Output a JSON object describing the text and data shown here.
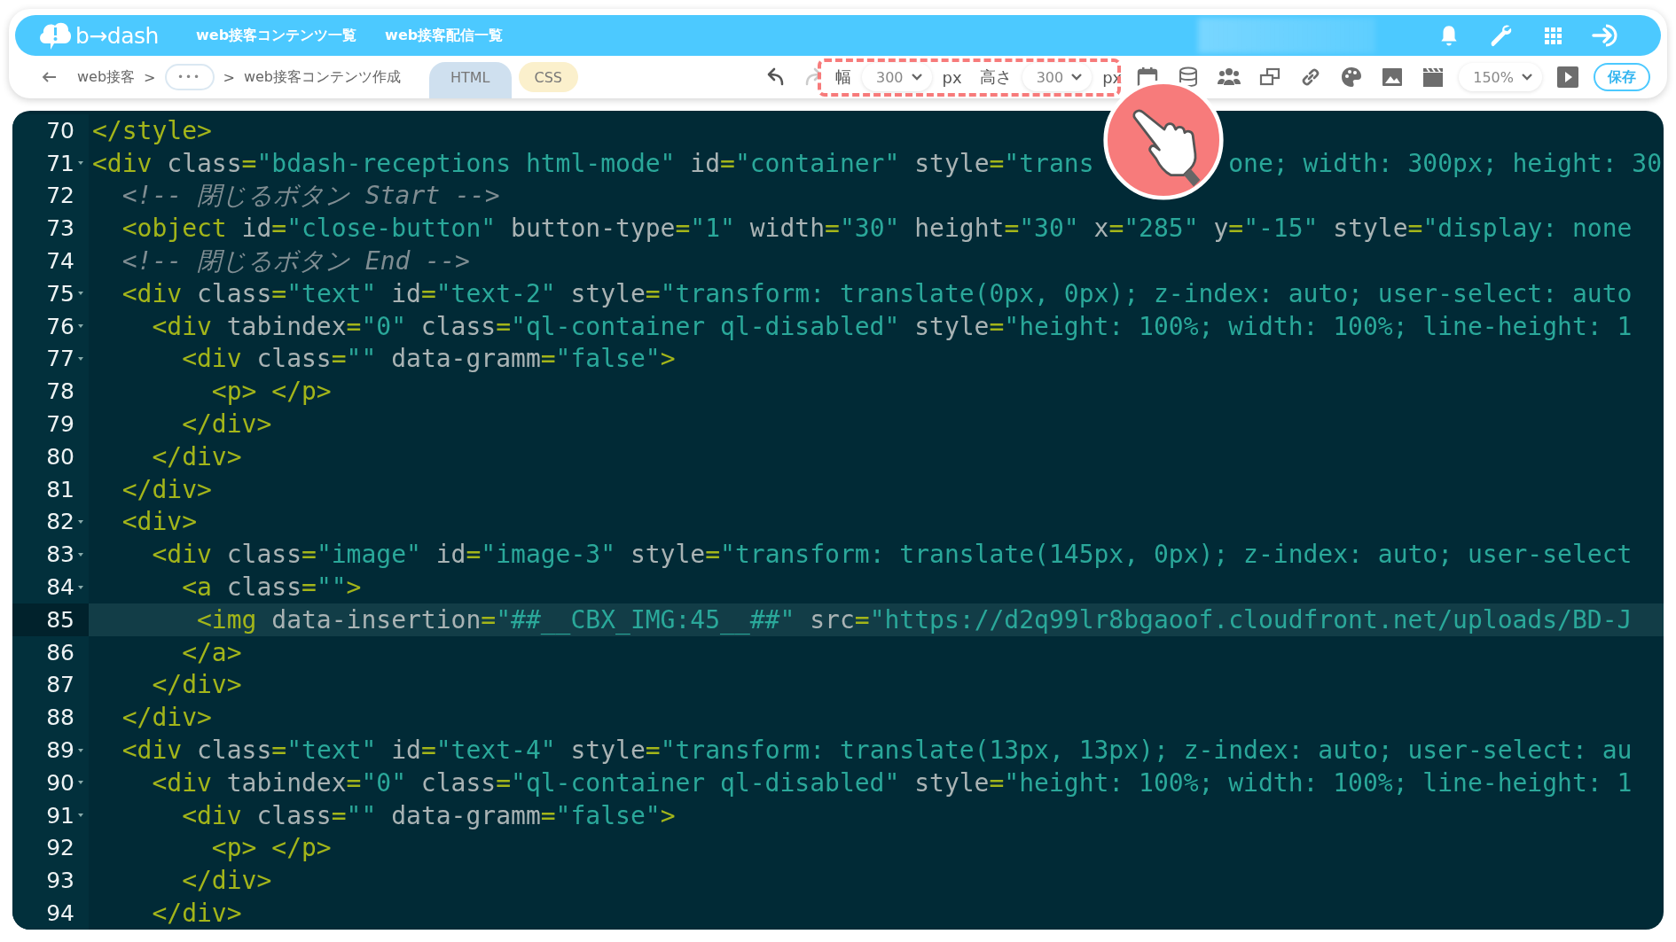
{
  "header": {
    "logo": "b→dash",
    "nav": [
      {
        "label": "web接客コンテンツ一覧"
      },
      {
        "label": "web接客配信一覧"
      }
    ]
  },
  "toolbar": {
    "breadcrumb": [
      {
        "kind": "link",
        "text": "web接客"
      },
      {
        "kind": "sep",
        "text": ">"
      },
      {
        "kind": "more",
        "text": "•••"
      },
      {
        "kind": "sep",
        "text": ">"
      },
      {
        "kind": "current",
        "text": "web接客コンテンツ作成"
      }
    ],
    "tabs": [
      {
        "label": "HTML",
        "selected": true,
        "color": "#cfe0ef"
      },
      {
        "label": "CSS",
        "selected": false,
        "color": "#fbf0cc"
      }
    ],
    "undo": {
      "disabled": false
    },
    "redo": {
      "disabled": true
    },
    "size": {
      "width_label": "幅",
      "width_value": "300",
      "width_unit": "px",
      "height_label": "高さ",
      "height_value": "300",
      "height_unit": "px"
    },
    "zoom": "150%",
    "save": "保存"
  },
  "editor": {
    "lines": [
      {
        "number": "70",
        "foldable": false,
        "active": false,
        "tokens": [
          {
            "kind": "tag",
            "text": "</style>"
          }
        ]
      },
      {
        "number": "71",
        "foldable": true,
        "active": false,
        "tokens": [
          {
            "kind": "tag",
            "text": "<div"
          },
          {
            "kind": "attr",
            "text": " class"
          },
          {
            "kind": "eq",
            "text": "="
          },
          {
            "kind": "str",
            "text": "\"bdash-receptions html-mode\""
          },
          {
            "kind": "attr",
            "text": " id"
          },
          {
            "kind": "eq",
            "text": "="
          },
          {
            "kind": "str",
            "text": "\"container\""
          },
          {
            "kind": "attr",
            "text": " style"
          },
          {
            "kind": "eq",
            "text": "="
          },
          {
            "kind": "str",
            "text": "\"trans"
          },
          {
            "kind": "str_after_overlay",
            "text": "one; width: 300px; height: 30"
          }
        ]
      },
      {
        "number": "72",
        "foldable": false,
        "active": false,
        "tokens": [
          {
            "kind": "comment",
            "text": "  <!-- 閉じるボタン Start -->"
          }
        ]
      },
      {
        "number": "73",
        "foldable": false,
        "active": false,
        "tokens": [
          {
            "kind": "tag",
            "text": "  <object"
          },
          {
            "kind": "attr",
            "text": " id"
          },
          {
            "kind": "eq",
            "text": "="
          },
          {
            "kind": "str",
            "text": "\"close-button\""
          },
          {
            "kind": "attr",
            "text": " button-type"
          },
          {
            "kind": "eq",
            "text": "="
          },
          {
            "kind": "str",
            "text": "\"1\""
          },
          {
            "kind": "attr",
            "text": " width"
          },
          {
            "kind": "eq",
            "text": "="
          },
          {
            "kind": "str",
            "text": "\"30\""
          },
          {
            "kind": "attr",
            "text": " height"
          },
          {
            "kind": "eq",
            "text": "="
          },
          {
            "kind": "str",
            "text": "\"30\""
          },
          {
            "kind": "attr",
            "text": " x"
          },
          {
            "kind": "eq",
            "text": "="
          },
          {
            "kind": "str",
            "text": "\"285\""
          },
          {
            "kind": "attr",
            "text": " y"
          },
          {
            "kind": "eq",
            "text": "="
          },
          {
            "kind": "str",
            "text": "\"-15\""
          },
          {
            "kind": "attr",
            "text": " style"
          },
          {
            "kind": "eq",
            "text": "="
          },
          {
            "kind": "str",
            "text": "\"display: none"
          }
        ]
      },
      {
        "number": "74",
        "foldable": false,
        "active": false,
        "tokens": [
          {
            "kind": "comment",
            "text": "  <!-- 閉じるボタン End -->"
          }
        ]
      },
      {
        "number": "75",
        "foldable": true,
        "active": false,
        "tokens": [
          {
            "kind": "tag",
            "text": "  <div"
          },
          {
            "kind": "attr",
            "text": " class"
          },
          {
            "kind": "eq",
            "text": "="
          },
          {
            "kind": "str",
            "text": "\"text\""
          },
          {
            "kind": "attr",
            "text": " id"
          },
          {
            "kind": "eq",
            "text": "="
          },
          {
            "kind": "str",
            "text": "\"text-2\""
          },
          {
            "kind": "attr",
            "text": " style"
          },
          {
            "kind": "eq",
            "text": "="
          },
          {
            "kind": "str",
            "text": "\"transform: translate(0px, 0px); z-index: auto; user-select: auto"
          }
        ]
      },
      {
        "number": "76",
        "foldable": true,
        "active": false,
        "tokens": [
          {
            "kind": "tag",
            "text": "    <div"
          },
          {
            "kind": "attr",
            "text": " tabindex"
          },
          {
            "kind": "eq",
            "text": "="
          },
          {
            "kind": "str",
            "text": "\"0\""
          },
          {
            "kind": "attr",
            "text": " class"
          },
          {
            "kind": "eq",
            "text": "="
          },
          {
            "kind": "str",
            "text": "\"ql-container ql-disabled\""
          },
          {
            "kind": "attr",
            "text": " style"
          },
          {
            "kind": "eq",
            "text": "="
          },
          {
            "kind": "str",
            "text": "\"height: 100%; width: 100%; line-height: 1"
          }
        ]
      },
      {
        "number": "77",
        "foldable": true,
        "active": false,
        "tokens": [
          {
            "kind": "tag",
            "text": "      <div"
          },
          {
            "kind": "attr",
            "text": " class"
          },
          {
            "kind": "eq",
            "text": "="
          },
          {
            "kind": "str",
            "text": "\"\""
          },
          {
            "kind": "attr",
            "text": " data-gramm"
          },
          {
            "kind": "eq",
            "text": "="
          },
          {
            "kind": "str",
            "text": "\"false\""
          },
          {
            "kind": "tag",
            "text": ">"
          }
        ]
      },
      {
        "number": "78",
        "foldable": false,
        "active": false,
        "tokens": [
          {
            "kind": "tag",
            "text": "        <p> </p>"
          }
        ]
      },
      {
        "number": "79",
        "foldable": false,
        "active": false,
        "tokens": [
          {
            "kind": "tag",
            "text": "      </div>"
          }
        ]
      },
      {
        "number": "80",
        "foldable": false,
        "active": false,
        "tokens": [
          {
            "kind": "tag",
            "text": "    </div>"
          }
        ]
      },
      {
        "number": "81",
        "foldable": false,
        "active": false,
        "tokens": [
          {
            "kind": "tag",
            "text": "  </div>"
          }
        ]
      },
      {
        "number": "82",
        "foldable": true,
        "active": false,
        "tokens": [
          {
            "kind": "tag",
            "text": "  <div>"
          }
        ]
      },
      {
        "number": "83",
        "foldable": true,
        "active": false,
        "tokens": [
          {
            "kind": "tag",
            "text": "    <div"
          },
          {
            "kind": "attr",
            "text": " class"
          },
          {
            "kind": "eq",
            "text": "="
          },
          {
            "kind": "str",
            "text": "\"image\""
          },
          {
            "kind": "attr",
            "text": " id"
          },
          {
            "kind": "eq",
            "text": "="
          },
          {
            "kind": "str",
            "text": "\"image-3\""
          },
          {
            "kind": "attr",
            "text": " style"
          },
          {
            "kind": "eq",
            "text": "="
          },
          {
            "kind": "str",
            "text": "\"transform: translate(145px, 0px); z-index: auto; user-select"
          }
        ]
      },
      {
        "number": "84",
        "foldable": true,
        "active": false,
        "tokens": [
          {
            "kind": "tag",
            "text": "      <a"
          },
          {
            "kind": "attr",
            "text": " class"
          },
          {
            "kind": "eq",
            "text": "="
          },
          {
            "kind": "str",
            "text": "\"\""
          },
          {
            "kind": "tag",
            "text": ">"
          }
        ]
      },
      {
        "number": "85",
        "foldable": false,
        "active": true,
        "tokens": [
          {
            "kind": "tag",
            "text": "       <img"
          },
          {
            "kind": "attr",
            "text": " data-insertion"
          },
          {
            "kind": "eq",
            "text": "="
          },
          {
            "kind": "str",
            "text": "\"##__CBX_IMG:45__##\""
          },
          {
            "kind": "attr",
            "text": " src"
          },
          {
            "kind": "eq",
            "text": "="
          },
          {
            "kind": "str",
            "text": "\"https://d2q99lr8bgaoof.cloudfront.net/uploads/BD-J"
          }
        ]
      },
      {
        "number": "86",
        "foldable": false,
        "active": false,
        "tokens": [
          {
            "kind": "tag",
            "text": "      </a>"
          }
        ]
      },
      {
        "number": "87",
        "foldable": false,
        "active": false,
        "tokens": [
          {
            "kind": "tag",
            "text": "    </div>"
          }
        ]
      },
      {
        "number": "88",
        "foldable": false,
        "active": false,
        "tokens": [
          {
            "kind": "tag",
            "text": "  </div>"
          }
        ]
      },
      {
        "number": "89",
        "foldable": true,
        "active": false,
        "tokens": [
          {
            "kind": "tag",
            "text": "  <div"
          },
          {
            "kind": "attr",
            "text": " class"
          },
          {
            "kind": "eq",
            "text": "="
          },
          {
            "kind": "str",
            "text": "\"text\""
          },
          {
            "kind": "attr",
            "text": " id"
          },
          {
            "kind": "eq",
            "text": "="
          },
          {
            "kind": "str",
            "text": "\"text-4\""
          },
          {
            "kind": "attr",
            "text": " style"
          },
          {
            "kind": "eq",
            "text": "="
          },
          {
            "kind": "str",
            "text": "\"transform: translate(13px, 13px); z-index: auto; user-select: au"
          }
        ]
      },
      {
        "number": "90",
        "foldable": true,
        "active": false,
        "tokens": [
          {
            "kind": "tag",
            "text": "    <div"
          },
          {
            "kind": "attr",
            "text": " tabindex"
          },
          {
            "kind": "eq",
            "text": "="
          },
          {
            "kind": "str",
            "text": "\"0\""
          },
          {
            "kind": "attr",
            "text": " class"
          },
          {
            "kind": "eq",
            "text": "="
          },
          {
            "kind": "str",
            "text": "\"ql-container ql-disabled\""
          },
          {
            "kind": "attr",
            "text": " style"
          },
          {
            "kind": "eq",
            "text": "="
          },
          {
            "kind": "str",
            "text": "\"height: 100%; width: 100%; line-height: 1"
          }
        ]
      },
      {
        "number": "91",
        "foldable": true,
        "active": false,
        "tokens": [
          {
            "kind": "tag",
            "text": "      <div"
          },
          {
            "kind": "attr",
            "text": " class"
          },
          {
            "kind": "eq",
            "text": "="
          },
          {
            "kind": "str",
            "text": "\"\""
          },
          {
            "kind": "attr",
            "text": " data-gramm"
          },
          {
            "kind": "eq",
            "text": "="
          },
          {
            "kind": "str",
            "text": "\"false\""
          },
          {
            "kind": "tag",
            "text": ">"
          }
        ]
      },
      {
        "number": "92",
        "foldable": false,
        "active": false,
        "tokens": [
          {
            "kind": "tag",
            "text": "        <p> </p>"
          }
        ]
      },
      {
        "number": "93",
        "foldable": false,
        "active": false,
        "tokens": [
          {
            "kind": "tag",
            "text": "      </div>"
          }
        ]
      },
      {
        "number": "94",
        "foldable": false,
        "active": false,
        "tokens": [
          {
            "kind": "tag",
            "text": "    </div>"
          }
        ]
      }
    ]
  }
}
